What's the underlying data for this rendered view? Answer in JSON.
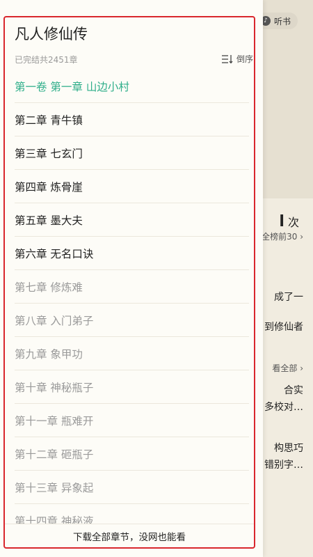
{
  "background": {
    "listen_label": "听书",
    "rank_count_suffix": "次",
    "rank_text": "全榜前30",
    "snippet_1": "成了一",
    "snippet_2": "到修仙者",
    "view_all": "看全部",
    "snippet_3": "合实",
    "snippet_4": "多校对…",
    "snippet_5": "构思巧",
    "snippet_6": "错别字…"
  },
  "drawer": {
    "title": "凡人修仙传",
    "status": "已完结共2451章",
    "sort_label": "倒序",
    "chapters": [
      {
        "label": "第一卷 第一章 山边小村",
        "state": "current"
      },
      {
        "label": "第二章 青牛镇",
        "state": "normal"
      },
      {
        "label": "第三章 七玄门",
        "state": "normal"
      },
      {
        "label": "第四章 炼骨崖",
        "state": "normal"
      },
      {
        "label": "第五章 墨大夫",
        "state": "normal"
      },
      {
        "label": "第六章 无名口诀",
        "state": "normal"
      },
      {
        "label": "第七章 修炼难",
        "state": "faded"
      },
      {
        "label": "第八章 入门弟子",
        "state": "faded"
      },
      {
        "label": "第九章 象甲功",
        "state": "faded"
      },
      {
        "label": "第十章 神秘瓶子",
        "state": "faded"
      },
      {
        "label": "第十一章 瓶难开",
        "state": "faded"
      },
      {
        "label": "第十二章 砸瓶子",
        "state": "faded"
      },
      {
        "label": "第十三章 异象起",
        "state": "faded"
      },
      {
        "label": "第十四章 神秘液",
        "state": "faded"
      }
    ],
    "download_label": "下载全部章节，没网也能看"
  },
  "colors": {
    "current_chapter": "#2fae8a",
    "highlight_border": "#d9262d"
  }
}
